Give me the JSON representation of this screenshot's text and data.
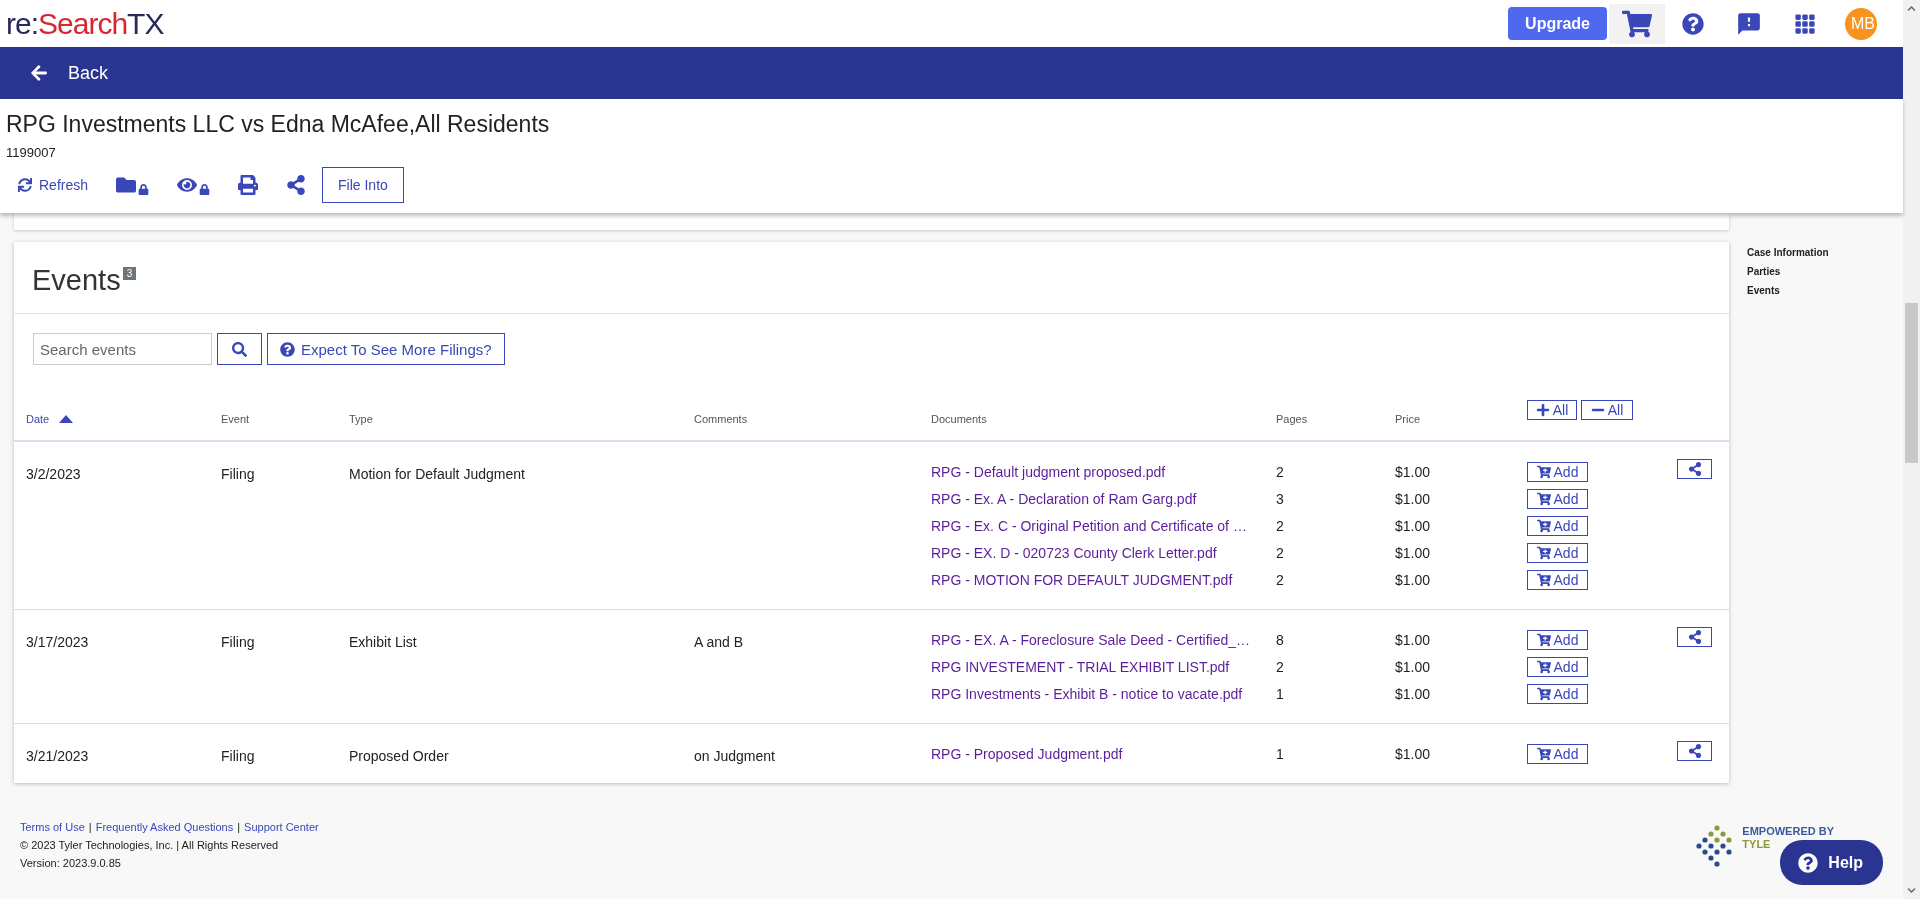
{
  "logo": {
    "prefix": "re:",
    "brand": "Search",
    "suffix": "TX"
  },
  "topbar": {
    "upgrade": "Upgrade",
    "avatar": "MB"
  },
  "navbar": {
    "back": "Back"
  },
  "case": {
    "title": "RPG Investments LLC vs Edna McAfee,All Residents",
    "number": "1199007",
    "actions": [
      {
        "kind": "refresh",
        "label": "Refresh"
      },
      {
        "kind": "folder-lock"
      },
      {
        "kind": "eye-lock"
      },
      {
        "kind": "print"
      },
      {
        "kind": "share"
      },
      {
        "kind": "outline",
        "label": "File Into"
      }
    ]
  },
  "side_nav": [
    "Case Information",
    "Parties",
    "Events"
  ],
  "events": {
    "title": "Events",
    "count": "3",
    "search": {
      "placeholder": "Search events"
    },
    "expect_button": "Expect To See More Filings?",
    "columns": [
      {
        "label": "Date",
        "sorted": true
      },
      {
        "label": "Event"
      },
      {
        "label": "Type"
      },
      {
        "label": "Comments"
      },
      {
        "label": "Documents"
      },
      {
        "label": "Pages"
      },
      {
        "label": "Price"
      }
    ],
    "add_all": "All",
    "remove_all": "All",
    "rows": [
      {
        "date": "3/2/2023",
        "event": "Filing",
        "type": "Motion for Default Judgment",
        "documents": [
          {
            "name": "RPG - Default judgment proposed.pdf",
            "pages": "2",
            "price": "$1.00",
            "button": "Add"
          },
          {
            "name": "RPG - Ex. A - Declaration of Ram Garg.pdf",
            "pages": "3",
            "price": "$1.00",
            "button": "Add"
          },
          {
            "name": "RPG - Ex. C - Original Petition and Certificate of …",
            "pages": "2",
            "price": "$1.00",
            "button": "Add"
          },
          {
            "name": "RPG - EX. D - 020723 County Clerk Letter.pdf",
            "pages": "2",
            "price": "$1.00",
            "button": "Add"
          },
          {
            "name": "RPG - MOTION FOR DEFAULT JUDGMENT.pdf",
            "pages": "2",
            "price": "$1.00",
            "button": "Add"
          }
        ]
      },
      {
        "date": "3/17/2023",
        "event": "Filing",
        "type": "Exhibit List",
        "comments": "A and B",
        "documents": [
          {
            "name": "RPG - EX. A - Foreclosure Sale Deed - Certified_…",
            "pages": "8",
            "price": "$1.00",
            "button": "Add"
          },
          {
            "name": "RPG INVESTEMENT - TRIAL EXHIBIT LIST.pdf",
            "pages": "2",
            "price": "$1.00",
            "button": "Add"
          },
          {
            "name": "RPG Investments - Exhibit B - notice to vacate.pdf",
            "pages": "1",
            "price": "$1.00",
            "button": "Add"
          }
        ]
      },
      {
        "date": "3/21/2023",
        "event": "Filing",
        "type": "Proposed Order",
        "comments": "on Judgment",
        "documents": [
          {
            "name": "RPG - Proposed Judgment.pdf",
            "pages": "1",
            "price": "$1.00",
            "button": "Add"
          }
        ]
      }
    ]
  },
  "footer": {
    "links": [
      {
        "kind": "link",
        "label": "Terms of Use"
      },
      {
        "kind": "separator",
        "label": "|"
      },
      {
        "kind": "link",
        "label": "Frequently Asked Questions"
      },
      {
        "kind": "separator",
        "label": "|"
      },
      {
        "kind": "link",
        "label": "Support Center"
      }
    ],
    "copyright": "© 2023 Tyler Technologies, Inc. | All Rights Reserved",
    "version": "Version: 2023.9.0.85",
    "badge": {
      "line1": "EMPOWERED BY",
      "line2": "TYLE"
    },
    "help": "Help"
  }
}
